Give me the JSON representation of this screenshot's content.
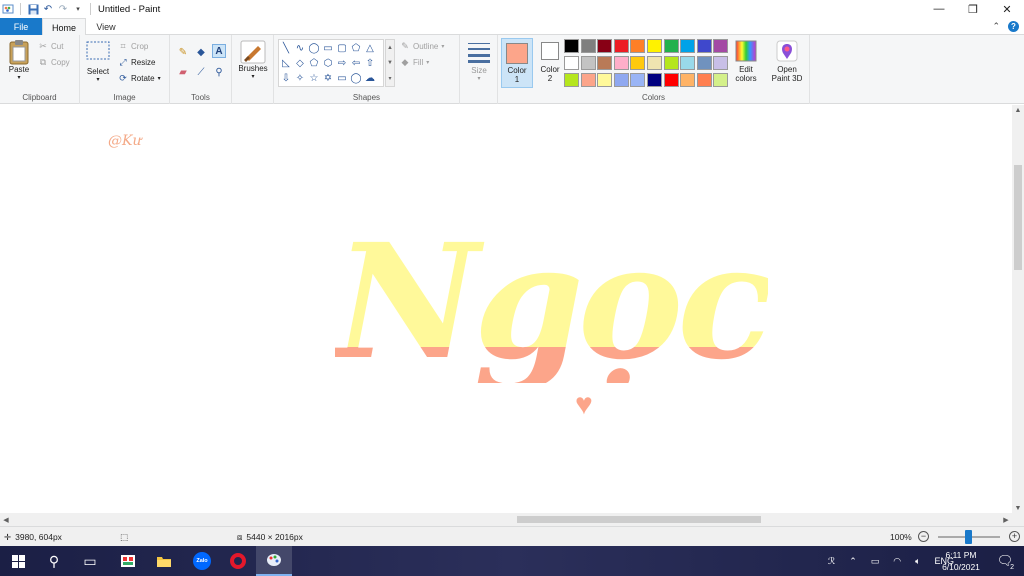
{
  "window": {
    "title": "Untitled - Paint",
    "quick_access": [
      "paint-app-icon",
      "save-icon",
      "undo-icon",
      "redo-icon",
      "customize-qat-icon"
    ]
  },
  "tabs": {
    "file": "File",
    "home": "Home",
    "view": "View"
  },
  "ribbon": {
    "clipboard": {
      "label": "Clipboard",
      "paste": "Paste",
      "cut": "Cut",
      "copy": "Copy"
    },
    "image": {
      "label": "Image",
      "select": "Select",
      "crop": "Crop",
      "resize": "Resize",
      "rotate": "Rotate"
    },
    "tools": {
      "label": "Tools"
    },
    "brushes": {
      "label": "Brushes"
    },
    "shapes": {
      "label": "Shapes",
      "outline": "Outline",
      "fill": "Fill"
    },
    "size": {
      "label": "Size"
    },
    "colors": {
      "label": "Colors",
      "color1_label": "Color",
      "color1_num": "1",
      "color2_label": "Color",
      "color2_num": "2",
      "color1_value": "#fca58a",
      "color2_value": "#ffffff",
      "edit_colors": "Edit",
      "edit_colors_2": "colors",
      "open_paint3d": "Open",
      "open_paint3d_2": "Paint 3D",
      "palette": [
        [
          "#000000",
          "#7f7f7f",
          "#880015",
          "#ed1c24",
          "#ff7f27",
          "#fff200",
          "#22b14c",
          "#00a2e8",
          "#3f48cc",
          "#a349a4"
        ],
        [
          "#ffffff",
          "#c3c3c3",
          "#b97a57",
          "#ffaec9",
          "#ffc90e",
          "#efe4b0",
          "#b5e61d",
          "#99d9ea",
          "#7092be",
          "#c8bfe7"
        ],
        [
          "#b5e61d",
          "#fca58a",
          "#fff99a",
          "#8fa8f0",
          "#99b4f5",
          "#000080",
          "#ff0000",
          "#ffb366",
          "#ff7f50",
          "#d4f08a"
        ]
      ]
    }
  },
  "canvas": {
    "watermark": "@Kư",
    "artwork_text": "Ngọc",
    "artwork_top_color": "#fff99a",
    "artwork_bottom_color": "#fca58a"
  },
  "status": {
    "cursor_pos": "3980, 604px",
    "image_size": "5440 × 2016px",
    "zoom": "100%"
  },
  "taskbar": {
    "apps": [
      "windows-start-icon",
      "search-icon",
      "task-view-icon",
      "app-icon",
      "file-explorer-icon",
      "zalo-icon",
      "opera-icon",
      "paint-icon"
    ],
    "zalo_label": "Zalo",
    "language": "ENG",
    "time": "6:11 PM",
    "date": "6/10/2021",
    "notification_count": "2"
  }
}
